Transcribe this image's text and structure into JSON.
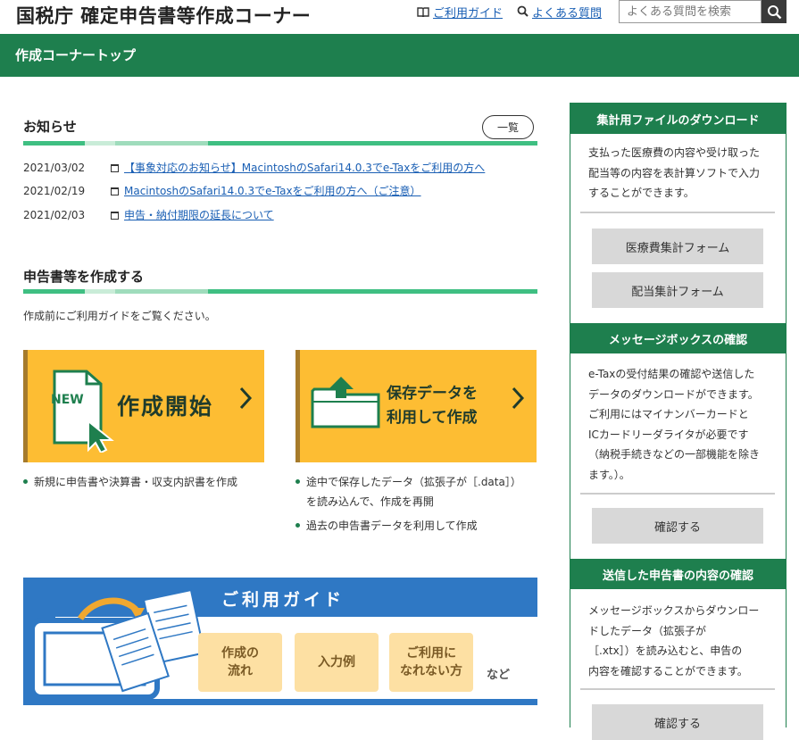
{
  "header": {
    "site_title": "国税庁 確定申告書等作成コーナー",
    "guide_link": "ご利用ガイド",
    "faq_link": "よくある質問",
    "search_placeholder": "よくある質問を検索",
    "breadcrumb": "作成コーナートップ"
  },
  "notices": {
    "title": "お知らせ",
    "list_button": "一覧",
    "items": [
      {
        "date": "2021/03/02",
        "text": "【事象対応のお知らせ】MacintoshのSafari14.0.3でe-Taxをご利用の方へ"
      },
      {
        "date": "2021/02/19",
        "text": "MacintoshのSafari14.0.3でe-Taxをご利用の方へ（ご注意）"
      },
      {
        "date": "2021/02/03",
        "text": "申告・納付期限の延長について"
      }
    ]
  },
  "create": {
    "title": "申告書等を作成する",
    "note": "作成前にご利用ガイドをご覧ください。",
    "new_card": {
      "badge": "NEW",
      "label": "作成開始"
    },
    "saved_card": {
      "label_line1": "保存データを",
      "label_line2": "利用して作成"
    },
    "new_bullets": [
      "新規に申告書や決算書・収支内訳書を作成"
    ],
    "saved_bullets": [
      "途中で保存したデータ（拡張子が［.data］）",
      "を読み込んで、作成を再開",
      "過去の申告書データを利用して作成"
    ]
  },
  "guide_banner": {
    "title": "ご利用ガイド",
    "box1_line1": "作成の",
    "box1_line2": "流れ",
    "box2": "入力例",
    "box3_line1": "ご利用に",
    "box3_line2": "なれない方",
    "suffix": "など"
  },
  "sidebar": {
    "download": {
      "title": "集計用ファイルのダウンロード",
      "lines": [
        "支払った医療費の内容や受け取った",
        "配当等の内容を表計算ソフトで入力",
        "することができます。"
      ],
      "btn_medical": "医療費集計フォーム",
      "btn_dividend": "配当集計フォーム"
    },
    "messagebox": {
      "title": "メッセージボックスの確認",
      "lines": [
        "e-Taxの受付結果の確認や送信した",
        "データのダウンロードができます。",
        "ご利用にはマイナンバーカードと",
        "ICカードリーダライタが必要です",
        "（納税手続きなどの一部機能を除き",
        "ます。）。"
      ],
      "btn_confirm": "確認する"
    },
    "sent": {
      "title": "送信した申告書の内容の確認",
      "lines": [
        "メッセージボックスからダウンロー",
        "ドしたデータ（拡張子が",
        "［.xtx］）を読み込むと、申告の",
        "内容を確認することができます。"
      ],
      "btn_confirm": "確認する"
    }
  },
  "colors": {
    "brand_green": "#1e7f4e",
    "accent_yellow": "#fdbd33",
    "guide_blue": "#2f78c4"
  }
}
